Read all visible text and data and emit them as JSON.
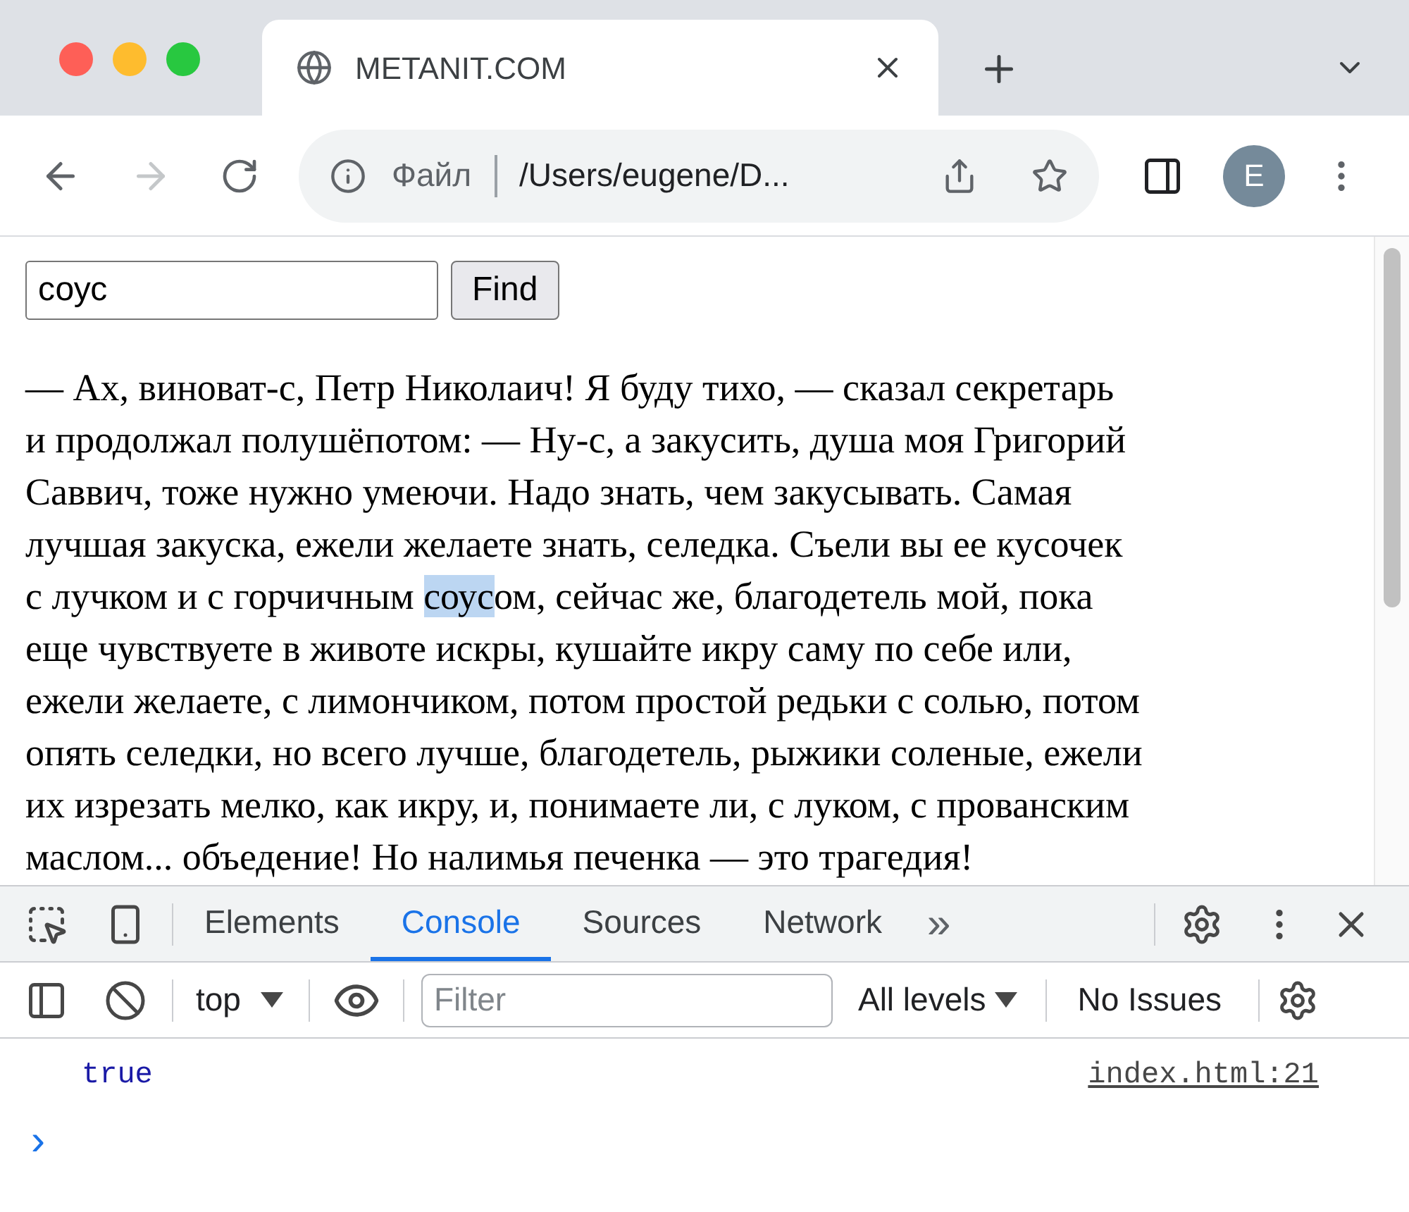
{
  "tab": {
    "title": "METANIT.COM"
  },
  "address_bar": {
    "scheme_label": "Файл",
    "url": "/Users/eugene/D..."
  },
  "profile": {
    "initial": "E"
  },
  "page": {
    "search": {
      "value": "соус"
    },
    "find_button": "Find",
    "paragraph_lines": [
      {
        "parts": [
          {
            "text": "— Ах, виноват-с, Петр Николаич! Я буду тихо, — сказал секретарь",
            "highlighted": false
          }
        ]
      },
      {
        "parts": [
          {
            "text": "и продолжал полушёпотом: — Ну-с, а закусить, душа моя Григорий",
            "highlighted": false
          }
        ]
      },
      {
        "parts": [
          {
            "text": "Саввич, тоже нужно умеючи. Надо знать, чем закусывать. Самая",
            "highlighted": false
          }
        ]
      },
      {
        "parts": [
          {
            "text": "лучшая закуска, ежели желаете знать, селедка. Съели вы ее кусочек",
            "highlighted": false
          }
        ]
      },
      {
        "parts": [
          {
            "text": "с лучком и с горчичным ",
            "highlighted": false
          },
          {
            "text": "соус",
            "highlighted": true
          },
          {
            "text": "ом, сейчас же, благодетель мой, пока",
            "highlighted": false
          }
        ]
      },
      {
        "parts": [
          {
            "text": "еще чувствуете в животе искры, кушайте икру саму по себе или,",
            "highlighted": false
          }
        ]
      },
      {
        "parts": [
          {
            "text": "ежели желаете, с лимончиком, потом простой редьки с солью, потом",
            "highlighted": false
          }
        ]
      },
      {
        "parts": [
          {
            "text": "опять селедки, но всего лучше, благодетель, рыжики соленые, ежели",
            "highlighted": false
          }
        ]
      },
      {
        "parts": [
          {
            "text": "их изрезать мелко, как икру, и, понимаете ли, с луком, с прованским",
            "highlighted": false
          }
        ]
      },
      {
        "parts": [
          {
            "text": "маслом... объедение! Но налимья печенка — это трагедия!",
            "highlighted": false
          }
        ]
      }
    ]
  },
  "devtools": {
    "tabs": [
      {
        "label": "Elements",
        "selected": false
      },
      {
        "label": "Console",
        "selected": true
      },
      {
        "label": "Sources",
        "selected": false
      },
      {
        "label": "Network",
        "selected": false
      }
    ],
    "more": "»",
    "context": "top",
    "filter": {
      "placeholder": "Filter"
    },
    "levels": "All levels",
    "issues": "No Issues",
    "messages": [
      {
        "text": "true",
        "source": "index.html:21"
      }
    ],
    "prompt": "›"
  }
}
